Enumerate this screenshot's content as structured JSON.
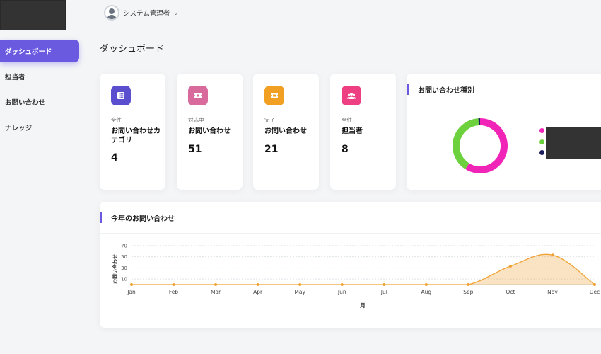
{
  "sidebar": {
    "items": [
      {
        "label": "ダッシュボード",
        "active": true
      },
      {
        "label": "担当者",
        "active": false
      },
      {
        "label": "お問い合わせ",
        "active": false
      },
      {
        "label": "ナレッジ",
        "active": false
      }
    ]
  },
  "header": {
    "user_name": "システム管理者",
    "chevron": "⌄"
  },
  "page": {
    "title": "ダッシュボード"
  },
  "stats": [
    {
      "sub": "全件",
      "label": "お問い合わせカテゴリ",
      "value": "4",
      "icon": "list-icon",
      "color": "#5b4fd0"
    },
    {
      "sub": "対応中",
      "label": "お問い合わせ",
      "value": "51",
      "icon": "ticket-icon",
      "color": "#d86b9c"
    },
    {
      "sub": "完了",
      "label": "お問い合わせ",
      "value": "21",
      "icon": "ticket-icon",
      "color": "#f2a024"
    },
    {
      "sub": "全件",
      "label": "担当者",
      "value": "8",
      "icon": "users-icon",
      "color": "#ee3f82"
    }
  ],
  "donut": {
    "title": "お問い合わせ種別",
    "slices": [
      {
        "color": "#f025b8",
        "value": 0.59
      },
      {
        "color": "#6dd13d",
        "value": 0.4
      },
      {
        "color": "#1a1d5c",
        "value": 0.01
      }
    ]
  },
  "line_chart": {
    "title": "今年のお問い合わせ",
    "chart_data": {
      "type": "area",
      "categories": [
        "Jan",
        "Feb",
        "Mar",
        "Apr",
        "May",
        "Jun",
        "Jul",
        "Aug",
        "Sep",
        "Oct",
        "Nov",
        "Dec"
      ],
      "values": [
        0,
        0,
        0,
        0,
        0,
        0,
        0,
        0,
        0,
        33,
        53,
        0
      ],
      "xlabel": "月",
      "ylabel": "お問い合わせ",
      "yticks": [
        "10",
        "30",
        "50",
        "70"
      ],
      "ylim": [
        0,
        75
      ],
      "color": "#f0a234",
      "grid": true
    }
  }
}
